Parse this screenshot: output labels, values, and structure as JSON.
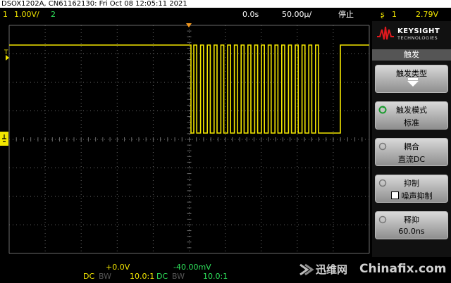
{
  "header": {
    "title": "DSOX1202A, CN61162130: Fri Oct 08 12:05:11 2021"
  },
  "status": {
    "ch1_index": "1",
    "ch1_scale": "1.00V/",
    "ch2_index": "2",
    "delay": "0.0s",
    "timebase": "50.00µ/",
    "run_state": "停止",
    "trigger_slope_icon": "ʂ",
    "trigger_source": "1",
    "trigger_level": "2.79V"
  },
  "markers": {
    "trigger_level_marker": "T"
  },
  "brand": {
    "name": "KEYSIGHT",
    "sub": "TECHNOLOGIES"
  },
  "menu": {
    "title": "触发",
    "buttons": [
      {
        "label": "触发类型",
        "value": ""
      },
      {
        "label": "触发模式",
        "value": "标准"
      },
      {
        "label": "耦合",
        "value": "直流DC"
      },
      {
        "label": "抑制",
        "value": "噪声抑制"
      },
      {
        "label": "释抑",
        "value": "60.0ns"
      }
    ]
  },
  "channels": {
    "ch1": {
      "offset": "+0.0V",
      "coupling": "DC",
      "bw": "BW",
      "probe": "10.0:1"
    },
    "ch2": {
      "offset": "-40.00mV",
      "coupling": "DC",
      "bw": "BW",
      "probe": "10.0:1"
    }
  },
  "watermark": {
    "site1": "迅维网",
    "site2": "Chinafix.com"
  },
  "colors": {
    "ch1": "#f2e600",
    "ch2": "#2ee25b",
    "grid": "#6a6a6a"
  }
}
